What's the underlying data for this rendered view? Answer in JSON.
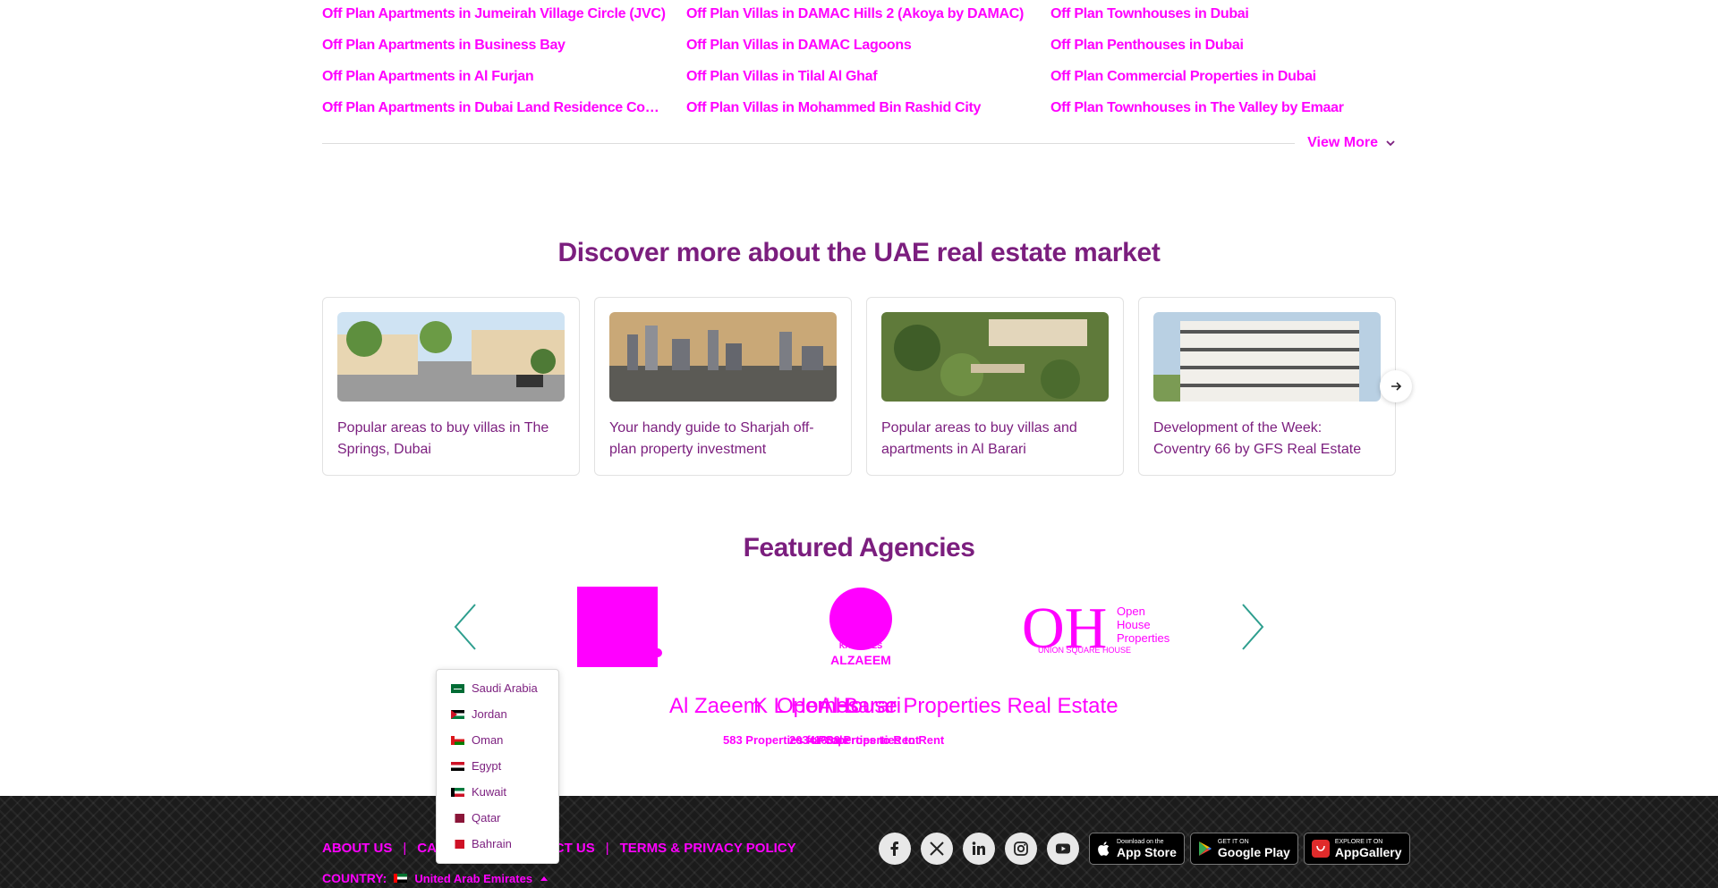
{
  "popular_links": {
    "col1": [
      "Off Plan Apartments in Jumeirah Village Circle (JVC)",
      "Off Plan Apartments in Business Bay",
      "Off Plan Apartments in Al Furjan",
      "Off Plan Apartments in Dubai Land Residence Compl..."
    ],
    "col2": [
      "Off Plan Villas in DAMAC Hills 2 (Akoya by DAMAC)",
      "Off Plan Villas in DAMAC Lagoons",
      "Off Plan Villas in Tilal Al Ghaf",
      "Off Plan Villas in Mohammed Bin Rashid City"
    ],
    "col3": [
      "Off Plan Townhouses in Dubai",
      "Off Plan Penthouses in Dubai",
      "Off Plan Commercial Properties in Dubai",
      "Off Plan Townhouses in The Valley by Emaar"
    ],
    "view_more": "View More"
  },
  "discover": {
    "title": "Discover more about the UAE real estate market",
    "cards": [
      {
        "caption": "Popular areas to buy villas in The Springs, Dubai"
      },
      {
        "caption": "Your handy guide to Sharjah off-plan property investment"
      },
      {
        "caption": "Popular areas to buy villas and apartments in Al Barari"
      },
      {
        "caption": "Development of the Week: Coventry 66 by GFS Real Estate"
      }
    ]
  },
  "featured": {
    "title": "Featured Agencies",
    "names": [
      "Al Zaeem",
      "K L Homes",
      "Al Barari",
      "Open House Properties Real Estate"
    ],
    "counts": [
      "583 Properties for Sale",
      "2034 Properties to Rent",
      "1639 Properties to Rent"
    ],
    "logo_texts": {
      "kl_top": "KA HOMES",
      "kl_bottom": "ALZAEEM",
      "oh_main": "OH",
      "oh_words": [
        "Open",
        "House",
        "Properties"
      ],
      "oh_sub": "UNION SQUARE HOUSE"
    }
  },
  "footer": {
    "links": [
      "ABOUT US",
      "CAREERS",
      "CONTACT US",
      "TERMS & PRIVACY POLICY"
    ],
    "separator": "|",
    "country_label": "COUNTRY:",
    "country_value": "United Arab Emirates",
    "stores": [
      {
        "small": "Download on the",
        "big": "App Store"
      },
      {
        "small": "GET IT ON",
        "big": "Google Play"
      },
      {
        "small": "EXPLORE IT ON",
        "big": "AppGallery"
      }
    ]
  },
  "country_dropdown": [
    "Saudi Arabia",
    "Jordan",
    "Oman",
    "Egypt",
    "Kuwait",
    "Qatar",
    "Bahrain"
  ],
  "colors": {
    "accent": "#ff00ff",
    "heading": "#7b1e7e",
    "footer_bg": "#1b1b1b"
  }
}
